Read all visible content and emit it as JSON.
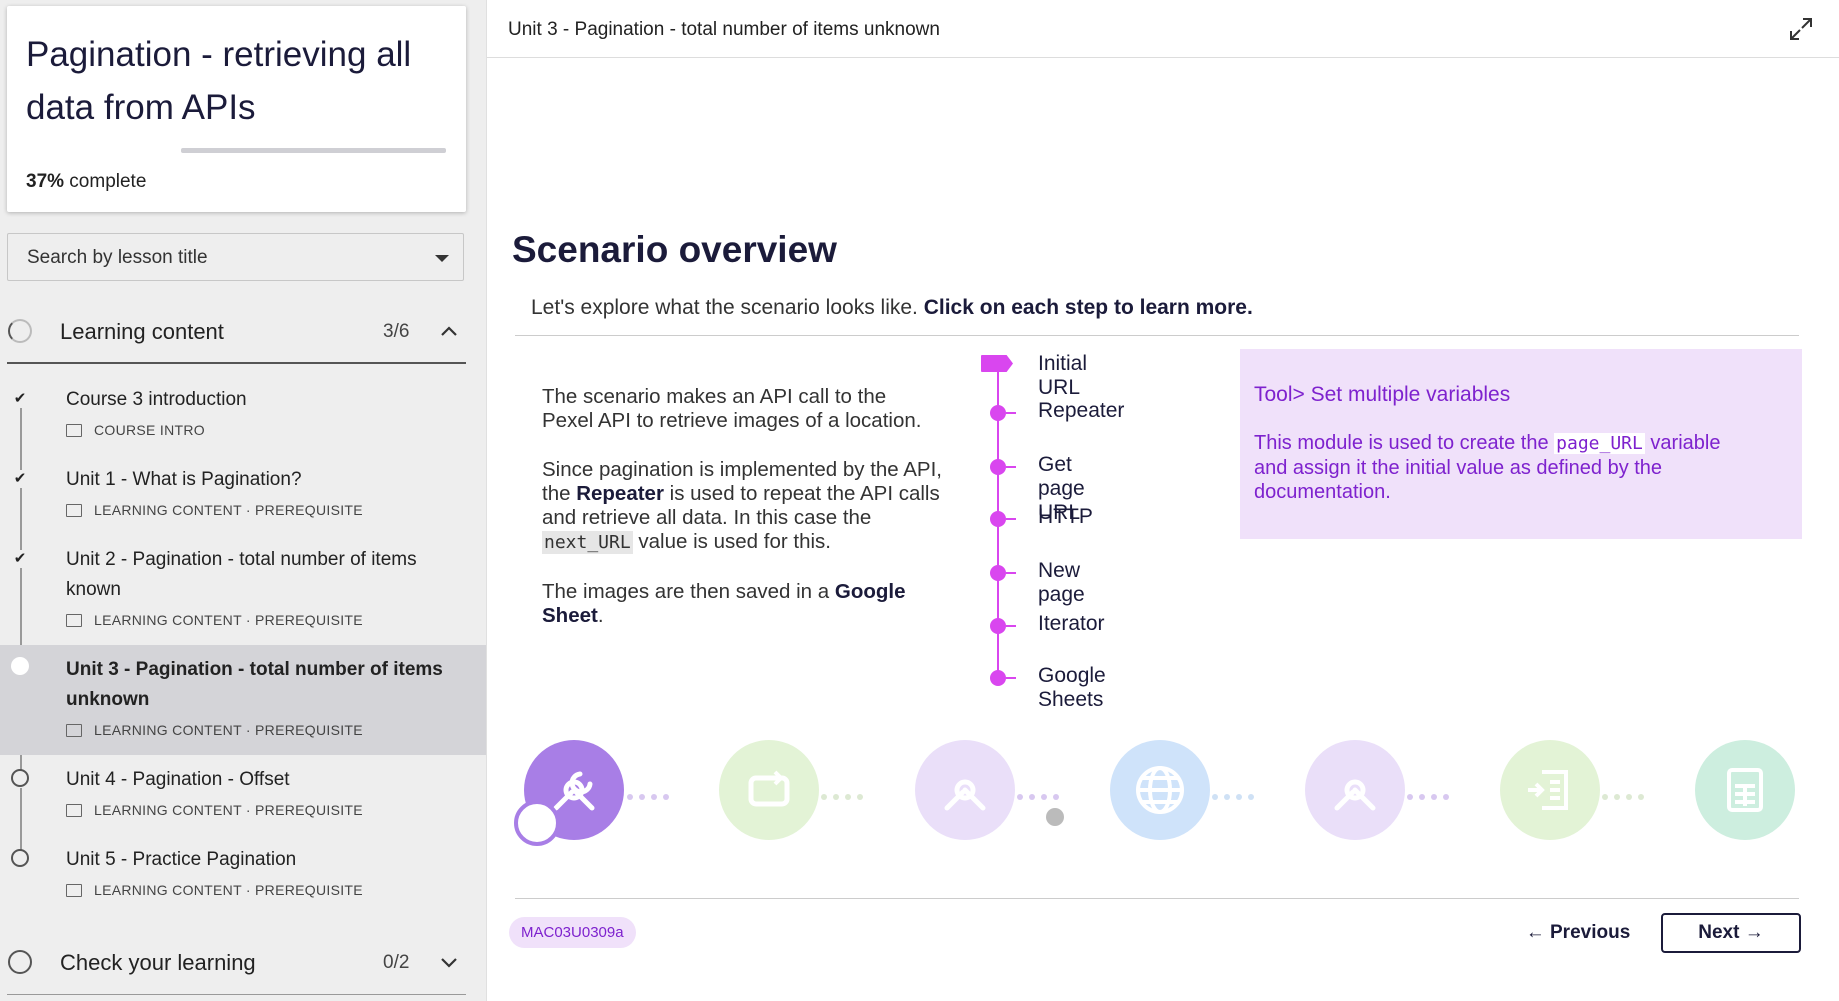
{
  "course": {
    "title": "Pagination - retrieving all data from APIs",
    "progress_percent": "37%",
    "progress_suffix": " complete",
    "progress_fraction": 0.37
  },
  "search": {
    "placeholder": "Search by lesson title"
  },
  "sections": [
    {
      "label": "Learning content",
      "count": "3/6",
      "chevron": "^"
    },
    {
      "label": "Check your learning",
      "count": "0/2",
      "chevron": "v"
    }
  ],
  "lessons": [
    {
      "title": "Course 3 introduction",
      "type": "COURSE INTRO",
      "tag": "",
      "state": "complete"
    },
    {
      "title": "Unit 1 - What is Pagination?",
      "type": "LEARNING CONTENT",
      "tag": "PREREQUISITE",
      "state": "complete"
    },
    {
      "title": "Unit 2 - Pagination - total number of items known",
      "type": "LEARNING CONTENT",
      "tag": "PREREQUISITE",
      "state": "complete"
    },
    {
      "title": "Unit 3 - Pagination - total number of items unknown",
      "type": "LEARNING CONTENT",
      "tag": "PREREQUISITE",
      "state": "current"
    },
    {
      "title": "Unit 4 - Pagination - Offset",
      "type": "LEARNING CONTENT",
      "tag": "PREREQUISITE",
      "state": "incomplete"
    },
    {
      "title": "Unit 5 - Practice Pagination",
      "type": "LEARNING CONTENT",
      "tag": "PREREQUISITE",
      "state": "incomplete"
    }
  ],
  "meta_separator": "·",
  "main": {
    "unit_title": "Unit 3 - Pagination - total number of items unknown",
    "heading": "Scenario overview",
    "intro_plain": "Let's explore what the scenario looks like. ",
    "intro_bold": "Click on each step to learn more.",
    "desc": {
      "p1": "The scenario makes an API call to the Pexel API to retrieve images of a location.",
      "p2_a": "Since pagination is implemented by the API, the ",
      "p2_b": "Repeater",
      "p2_c": " is used to repeat the API calls and retrieve all data. In this case the ",
      "p2_code": "next_URL",
      "p2_d": " value is used for this.",
      "p3_a": "The images are then saved in a ",
      "p3_b": "Google Sheet",
      "p3_c": "."
    },
    "steps": [
      "Initial URL",
      "Repeater",
      "Get page URL",
      "HTTP",
      "New page",
      "Iterator",
      "Google Sheets"
    ],
    "info": {
      "title": "Tool> Set multiple variables",
      "body_a": "This module is used to create the ",
      "body_code": "page_URL",
      "body_b": " variable and assign it the initial value as defined by the documentation."
    },
    "modules": [
      {
        "name": "Set multiple variables",
        "icon": "tools-icon",
        "color": "#a87ee6",
        "active": true
      },
      {
        "name": "Repeater",
        "icon": "repeat-icon",
        "color": "#a3e07f",
        "active": false
      },
      {
        "name": "Get page URL",
        "icon": "tools-icon",
        "color": "#a87ee6",
        "active": false
      },
      {
        "name": "HTTP",
        "icon": "globe-icon",
        "color": "#3b9ae8",
        "active": false
      },
      {
        "name": "New page",
        "icon": "tools-icon",
        "color": "#a87ee6",
        "active": false
      },
      {
        "name": "Iterator",
        "icon": "iterator-icon",
        "color": "#a3e07f",
        "active": false
      },
      {
        "name": "Google Sheets",
        "icon": "sheet-icon",
        "color": "#34c28a",
        "active": false
      }
    ],
    "code": "MAC03U0309a",
    "prev_label": "Previous",
    "next_label": "Next"
  },
  "colors": {
    "accent": "#d946ef",
    "brand_text": "#1b1b3a",
    "info_bg": "#f0e1fa",
    "info_text": "#7e22ce"
  }
}
